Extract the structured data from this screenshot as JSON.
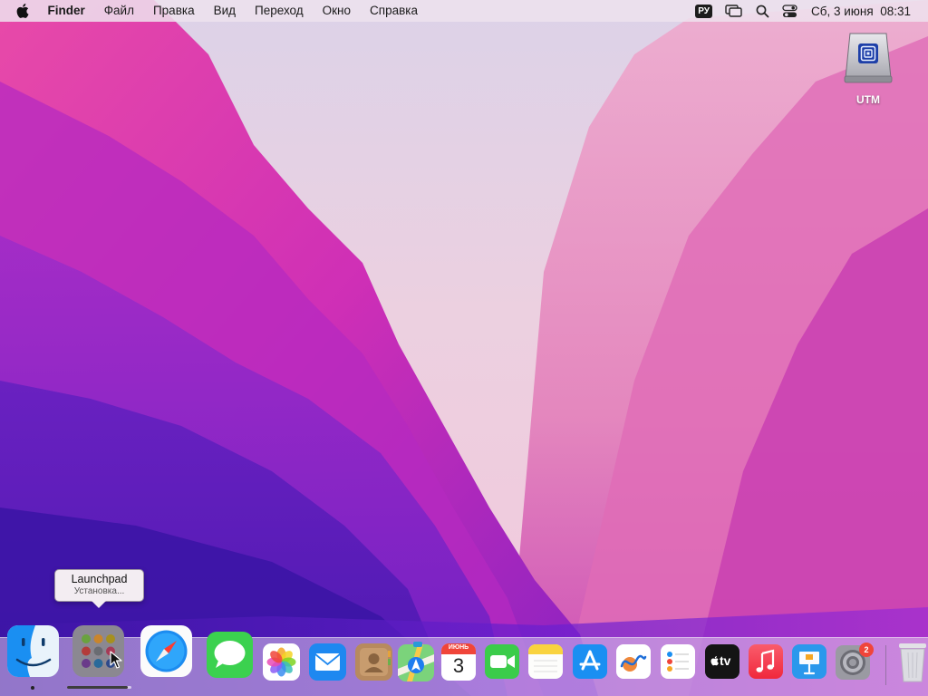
{
  "menubar": {
    "app_name": "Finder",
    "menus": [
      "Файл",
      "Правка",
      "Вид",
      "Переход",
      "Окно",
      "Справка"
    ],
    "input_source": "РУ",
    "date": "Сб, 3 июня",
    "time": "08:31"
  },
  "desktop": {
    "drive_label": "UTM"
  },
  "tooltip": {
    "title": "Launchpad",
    "subtitle": "Установка..."
  },
  "dock": {
    "calendar_month": "ИЮНЬ",
    "calendar_day": "3",
    "appletv_text": "tv",
    "settings_badge": "2",
    "launchpad_progress": 0.95
  },
  "colors": {
    "menubar_bg": "#eee2ee",
    "dock_bg": "#f0e1f0",
    "tooltip_bg": "#f3edf2"
  }
}
